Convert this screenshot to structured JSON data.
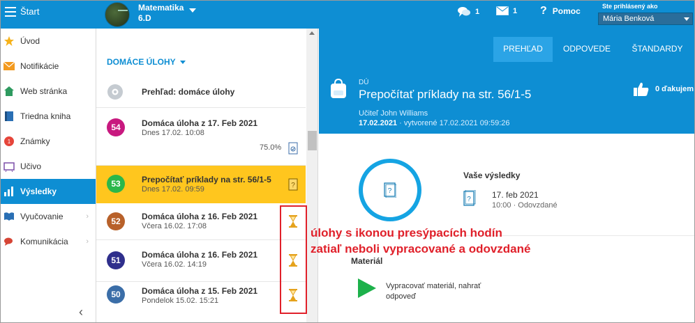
{
  "topbar": {
    "start_label": "Štart",
    "class_subject": "Matematika",
    "class_name": "6.D",
    "messages_count": "1",
    "mail_count": "1",
    "help_label": "Pomoc",
    "logged_as_label": "Ste prihlásený ako",
    "user_name": "Mária Benková"
  },
  "sidebar": {
    "items": [
      {
        "label": "Úvod",
        "icon": "star-icon"
      },
      {
        "label": "Notifikácie",
        "icon": "envelope-icon"
      },
      {
        "label": "Web stránka",
        "icon": "house-icon"
      },
      {
        "label": "Triedna kniha",
        "icon": "book-icon"
      },
      {
        "label": "Známky",
        "icon": "grade-icon"
      },
      {
        "label": "Učivo",
        "icon": "board-icon"
      },
      {
        "label": "Výsledky",
        "icon": "chart-icon"
      },
      {
        "label": "Vyučovanie",
        "icon": "open-book-icon"
      },
      {
        "label": "Komunikácia",
        "icon": "chat-icon"
      }
    ]
  },
  "list": {
    "header": "DOMÁCE ÚLOHY",
    "overview_label": "Prehľad: domáce úlohy",
    "items": [
      {
        "number": "54",
        "title": "Domáca úloha z 17. Feb 2021",
        "date": "Dnes 17.02. 10:08",
        "percent": "75.0%",
        "color": "#c8197f"
      },
      {
        "number": "53",
        "title": "Prepočítať príklady na str. 56/1-5",
        "date": "Dnes 17.02. 09:59",
        "color": "#2bb74a"
      },
      {
        "number": "52",
        "title": "Domáca úloha z 16. Feb 2021",
        "date": "Včera 16.02. 17:08",
        "color": "#b8612a"
      },
      {
        "number": "51",
        "title": "Domáca úloha z 16. Feb 2021",
        "date": "Včera 16.02. 14:19",
        "color": "#2f2f8c"
      },
      {
        "number": "50",
        "title": "Domáca úloha z 15. Feb 2021",
        "date": "Pondelok 15.02. 15:21",
        "color": "#3b6ea8"
      }
    ]
  },
  "annotation": {
    "line1": "úlohy s ikonou presýpacích hodín",
    "line2": "zatiaľ neboli vypracované a odovzdané"
  },
  "detail": {
    "tabs": [
      "PREHĽAD",
      "ODPOVEDE",
      "ŠTANDARDY"
    ],
    "type_label": "DÚ",
    "title": "Prepočítať príklady na str. 56/1-5",
    "teacher": "Učiteľ John Williams",
    "date_bold": "17.02.2021",
    "created": " · vytvorené 17.02.2021 09:59:26",
    "likes": "0 ďakujem",
    "results_title": "Vaše výsledky",
    "result_date": "17. feb 2021",
    "result_time": "10:00 · Odovzdané",
    "material_label": "Materiál",
    "material_text": "Vypracovať materiál, nahrať odpoveď"
  }
}
